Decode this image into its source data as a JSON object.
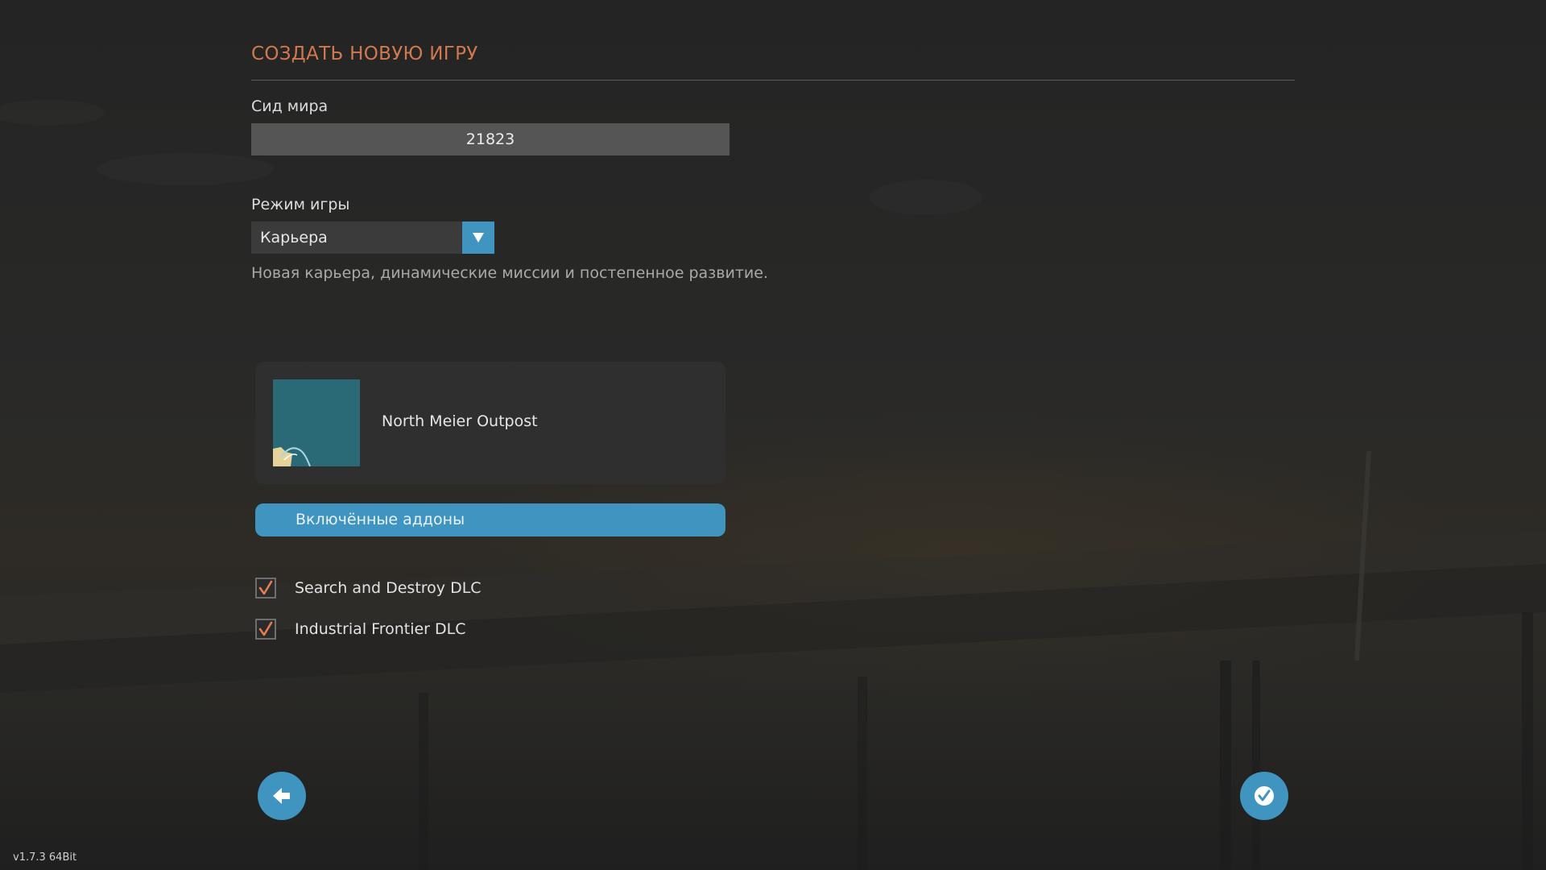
{
  "header": {
    "title": "СОЗДАТЬ НОВУЮ ИГРУ"
  },
  "seed": {
    "label": "Сид мира",
    "value": "21823"
  },
  "game_mode": {
    "label": "Режим игры",
    "selected": "Карьера",
    "description": "Новая карьера, динамические миссии и постепенное развитие."
  },
  "map": {
    "name": "North Meier Outpost"
  },
  "addons": {
    "header": "Включённые аддоны",
    "items": [
      {
        "label": "Search and Destroy DLC",
        "checked": true
      },
      {
        "label": "Industrial Frontier DLC",
        "checked": true
      }
    ]
  },
  "footer": {
    "version": "v1.7.3 64Bit"
  },
  "icons": {
    "back": "arrow-left-icon",
    "confirm": "check-circle-icon",
    "dropdown": "chevron-down-icon"
  },
  "colors": {
    "accent_blue": "#3f95c0",
    "title_orange": "#d2784f",
    "check_orange": "#e27d52"
  }
}
